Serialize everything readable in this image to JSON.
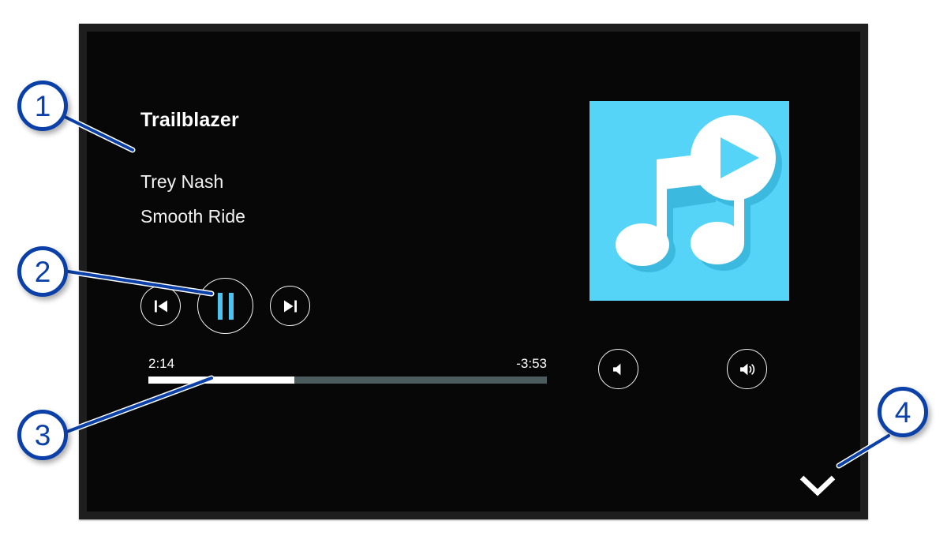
{
  "screen": {
    "background_color": "#070707",
    "frame_color": "#1e1e1e"
  },
  "track": {
    "title": "Trailblazer",
    "artist": "Trey Nash",
    "album": "Smooth Ride"
  },
  "album_art": {
    "background_color": "#55d4f8",
    "art_icon": "music-note-play-icon",
    "note_color": "#ffffff",
    "shadow_color": "#3cb9df"
  },
  "transport": {
    "previous_label": "Previous",
    "previous_icon": "skip-previous-icon",
    "play_pause_label": "Pause",
    "play_pause_icon": "pause-icon",
    "play_pause_state": "playing",
    "pause_bar_color": "#4ec3f0",
    "next_label": "Next",
    "next_icon": "skip-next-icon"
  },
  "progress": {
    "elapsed": "2:14",
    "remaining": "-3:53",
    "percent": 36.6,
    "fill_color": "#ffffff",
    "track_color": "#4c5c5e"
  },
  "volume": {
    "down_label": "Volume Down",
    "down_icon": "volume-low-icon",
    "up_label": "Volume Up",
    "up_icon": "volume-high-icon"
  },
  "collapse": {
    "label": "Collapse",
    "icon": "chevron-down-icon"
  },
  "callouts": {
    "accent_color": "#0b40a8",
    "items": [
      {
        "number": "1",
        "target": "track-info"
      },
      {
        "number": "2",
        "target": "transport-controls"
      },
      {
        "number": "3",
        "target": "progress-section"
      },
      {
        "number": "4",
        "target": "collapse-button"
      }
    ]
  }
}
